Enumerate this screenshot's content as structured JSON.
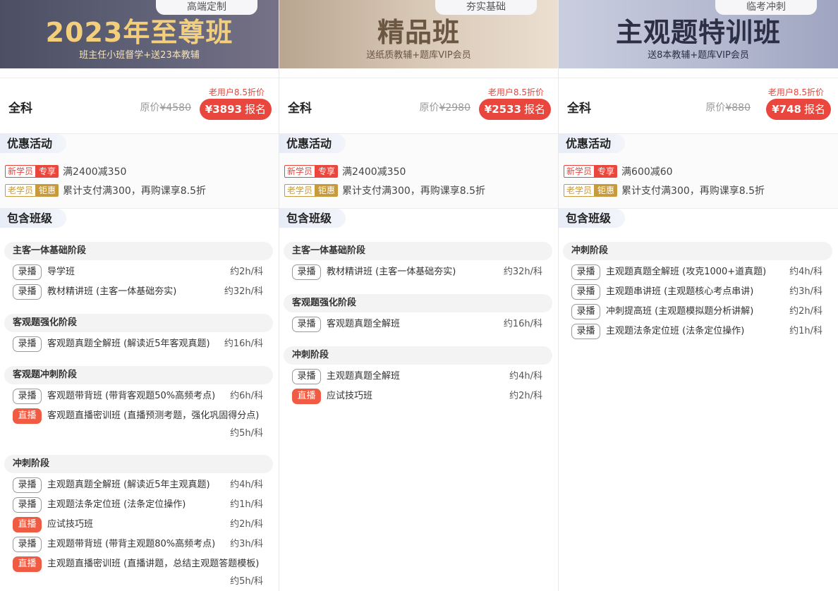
{
  "columns": [
    {
      "tag": "高端定制",
      "title": "2023年至尊班",
      "subtitle": "班主任小班督学+送23本教辅",
      "subject": "全科",
      "orig_label": "原价",
      "orig_price": "¥4580",
      "discount": "老用户8.5折价",
      "price": "¥3893",
      "buy_label": "报名",
      "promo_title": "优惠活动",
      "promos": [
        {
          "a": "新学员",
          "b": "专享",
          "text": "满2400减350"
        },
        {
          "a": "老学员",
          "b": "钜惠",
          "text": "累计支付满300，再购课享8.5折"
        }
      ],
      "classes_title": "包含班级",
      "stages": [
        {
          "title": "主客一体基础阶段",
          "courses": [
            {
              "type": "录播",
              "name": "导学班",
              "dur": "约2h/科"
            },
            {
              "type": "录播",
              "name": "教材精讲班 (主客一体基础夯实)",
              "dur": "约32h/科"
            }
          ]
        },
        {
          "title": "客观题强化阶段",
          "courses": [
            {
              "type": "录播",
              "name": "客观题真题全解班 (解读近5年客观真题)",
              "dur": "约16h/科"
            }
          ]
        },
        {
          "title": "客观题冲刺阶段",
          "courses": [
            {
              "type": "录播",
              "name": "客观题带背班 (带背客观题50%高频考点)",
              "dur": "约6h/科"
            },
            {
              "type": "直播",
              "name": "客观题直播密训班 (直播预测考题，强化巩固得分点)",
              "dur": "约5h/科"
            }
          ]
        },
        {
          "title": "冲刺阶段",
          "courses": [
            {
              "type": "录播",
              "name": "主观题真题全解班 (解读近5年主观真题)",
              "dur": "约4h/科"
            },
            {
              "type": "录播",
              "name": "主观题法条定位班 (法条定位操作)",
              "dur": "约1h/科"
            },
            {
              "type": "直播",
              "name": "应试技巧班",
              "dur": "约2h/科"
            },
            {
              "type": "录播",
              "name": "主观题带背班 (带背主观题80%高频考点)",
              "dur": "约3h/科"
            },
            {
              "type": "直播",
              "name": "主观题直播密训班 (直播讲题，总结主观题答题模板)",
              "dur": "约5h/科"
            }
          ]
        }
      ]
    },
    {
      "tag": "夯实基础",
      "title": "精品班",
      "subtitle": "送纸质教辅+题库VIP会员",
      "subject": "全科",
      "orig_label": "原价",
      "orig_price": "¥2980",
      "discount": "老用户8.5折价",
      "price": "¥2533",
      "buy_label": "报名",
      "promo_title": "优惠活动",
      "promos": [
        {
          "a": "新学员",
          "b": "专享",
          "text": "满2400减350"
        },
        {
          "a": "老学员",
          "b": "钜惠",
          "text": "累计支付满300，再购课享8.5折"
        }
      ],
      "classes_title": "包含班级",
      "stages": [
        {
          "title": "主客一体基础阶段",
          "courses": [
            {
              "type": "录播",
              "name": "教材精讲班 (主客一体基础夯实)",
              "dur": "约32h/科"
            }
          ]
        },
        {
          "title": "客观题强化阶段",
          "courses": [
            {
              "type": "录播",
              "name": "客观题真题全解班",
              "dur": "约16h/科"
            }
          ]
        },
        {
          "title": "冲刺阶段",
          "courses": [
            {
              "type": "录播",
              "name": "主观题真题全解班",
              "dur": "约4h/科"
            },
            {
              "type": "直播",
              "name": "应试技巧班",
              "dur": "约2h/科"
            }
          ]
        }
      ]
    },
    {
      "tag": "临考冲刺",
      "title": "主观题特训班",
      "subtitle": "送8本教辅+题库VIP会员",
      "subject": "全科",
      "orig_label": "原价",
      "orig_price": "¥880",
      "discount": "老用户8.5折价",
      "price": "¥748",
      "buy_label": "报名",
      "promo_title": "优惠活动",
      "promos": [
        {
          "a": "新学员",
          "b": "专享",
          "text": "满600减60"
        },
        {
          "a": "老学员",
          "b": "钜惠",
          "text": "累计支付满300，再购课享8.5折"
        }
      ],
      "classes_title": "包含班级",
      "stages": [
        {
          "title": "冲刺阶段",
          "courses": [
            {
              "type": "录播",
              "name": "主观题真题全解班 (攻克1000+道真题)",
              "dur": "约4h/科"
            },
            {
              "type": "录播",
              "name": "主观题串讲班 (主观题核心考点串讲)",
              "dur": "约3h/科"
            },
            {
              "type": "录播",
              "name": "冲刺提高班 (主观题模拟题分析讲解)",
              "dur": "约2h/科"
            },
            {
              "type": "录播",
              "name": "主观题法条定位班 (法条定位操作)",
              "dur": "约1h/科"
            }
          ]
        }
      ]
    }
  ],
  "colors": {
    "accent": "#e9473e",
    "gold": "#c79a3c",
    "live": "#ef5b43"
  }
}
